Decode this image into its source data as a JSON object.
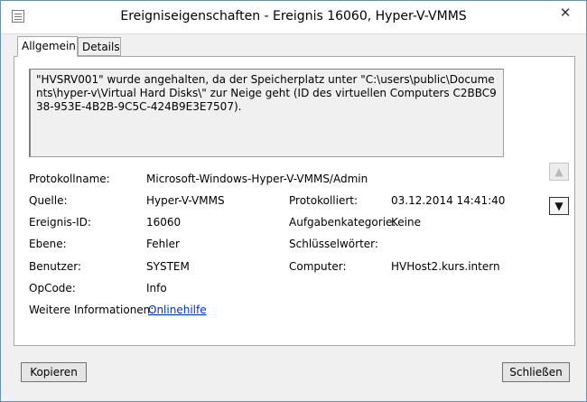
{
  "window": {
    "title": "Ereigniseigenschaften - Ereignis 16060, Hyper-V-VMMS",
    "close_glyph": "✕"
  },
  "tabs": [
    {
      "label": "Allgemein",
      "active": true
    },
    {
      "label": "Details",
      "active": false
    }
  ],
  "description": "\"HVSRV001\" wurde angehalten, da der Speicherplatz unter \"C:\\users\\public\\Documents\\hyper-v\\Virtual Hard Disks\\\" zur Neige geht (ID des virtuellen Computers C2BBC938-953E-4B2B-9C5C-424B9E3E7507).",
  "fields": {
    "protokollname": {
      "label": "Protokollname:",
      "value": "Microsoft-Windows-Hyper-V-VMMS/Admin"
    },
    "quelle": {
      "label": "Quelle:",
      "value": "Hyper-V-VMMS"
    },
    "protokolliert": {
      "label": "Protokolliert:",
      "value": "03.12.2014 14:41:40"
    },
    "ereignis_id": {
      "label": "Ereignis-ID:",
      "value": "16060"
    },
    "aufgabenkategorie": {
      "label": "Aufgabenkategorie:",
      "value": "Keine"
    },
    "ebene": {
      "label": "Ebene:",
      "value": "Fehler"
    },
    "schluesselwoerter": {
      "label": "Schlüsselwörter:",
      "value": ""
    },
    "benutzer": {
      "label": "Benutzer:",
      "value": "SYSTEM"
    },
    "computer": {
      "label": "Computer:",
      "value": "HVHost2.kurs.intern"
    },
    "opcode": {
      "label": "OpCode:",
      "value": "Info"
    },
    "weitere": {
      "label": "Weitere Informationen:",
      "value": "Onlinehilfe"
    }
  },
  "nav": {
    "up_glyph": "▲",
    "down_glyph": "▼"
  },
  "buttons": {
    "copy": "Kopieren",
    "close": "Schließen"
  }
}
